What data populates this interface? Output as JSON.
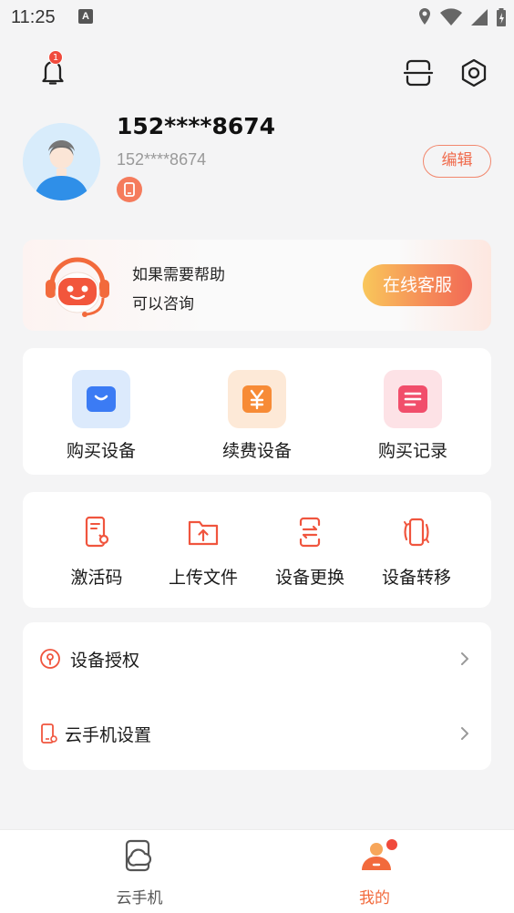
{
  "status_bar": {
    "time": "11:25",
    "notification_letter": "A"
  },
  "header": {
    "notification_count": "1"
  },
  "profile": {
    "name": "152****8674",
    "phone": "152****8674",
    "edit_label": "编辑"
  },
  "help": {
    "line1": "如果需要帮助",
    "line2": "可以咨询",
    "button_label": "在线客服"
  },
  "purchase": {
    "items": [
      {
        "label": "购买设备",
        "icon": "shopping-bag-icon"
      },
      {
        "label": "续费设备",
        "icon": "yen-icon"
      },
      {
        "label": "购买记录",
        "icon": "list-icon"
      }
    ]
  },
  "tools": {
    "items": [
      {
        "label": "激活码",
        "icon": "activation-code-icon"
      },
      {
        "label": "上传文件",
        "icon": "upload-folder-icon"
      },
      {
        "label": "设备更换",
        "icon": "device-swap-icon"
      },
      {
        "label": "设备转移",
        "icon": "device-transfer-icon"
      }
    ]
  },
  "settings_list": {
    "items": [
      {
        "label": "设备授权",
        "icon": "authorization-icon"
      },
      {
        "label": "云手机设置",
        "icon": "phone-settings-icon"
      }
    ]
  },
  "tab_bar": {
    "tabs": [
      {
        "label": "云手机",
        "active": false
      },
      {
        "label": "我的",
        "active": true
      }
    ]
  },
  "colors": {
    "accent": "#f06a4b",
    "active_tab": "#f26a3c",
    "inactive_tab": "#555555",
    "badge": "#f04a3c"
  }
}
